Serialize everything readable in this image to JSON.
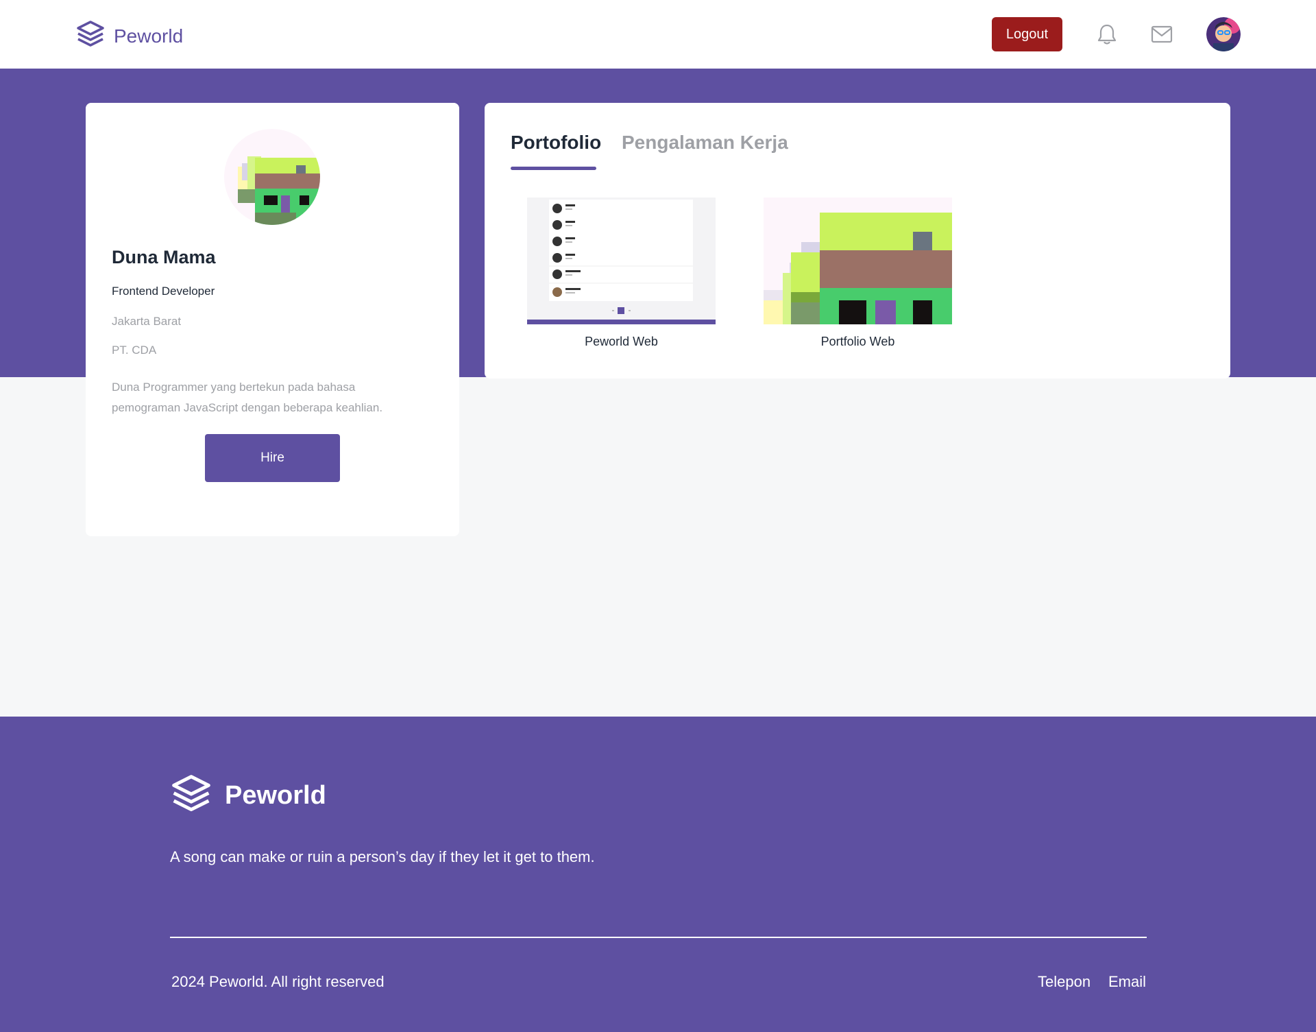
{
  "navbar": {
    "brand": "Peworld",
    "logout_label": "Logout",
    "icons": [
      "logo-icon",
      "bell-icon",
      "mail-icon"
    ],
    "logout_color": "#9b1c1c"
  },
  "profile": {
    "name": "Duna Mama",
    "role": "Frontend Developer",
    "location": "Jakarta Barat",
    "company": "PT. CDA",
    "description": "Duna Programmer yang bertekun pada bahasa pemograman JavaScript dengan beberapa keahlian.",
    "hire_label": "Hire"
  },
  "tabs": {
    "active": "Portofolio",
    "inactive": "Pengalaman Kerja"
  },
  "portfolio": [
    {
      "title": "Peworld Web"
    },
    {
      "title": "Portfolio Web"
    }
  ],
  "footer": {
    "brand": "Peworld",
    "tagline": "A song can make or ruin a person’s day if they let it get to them.",
    "copyright": "2024 Peworld. All right reserved",
    "phone_link": "Telepon",
    "email_link": "Email"
  },
  "colors": {
    "primary": "#5e50a1",
    "danger": "#9b1c1c",
    "muted": "#9ea0a5",
    "background": "#f6f7f8"
  }
}
